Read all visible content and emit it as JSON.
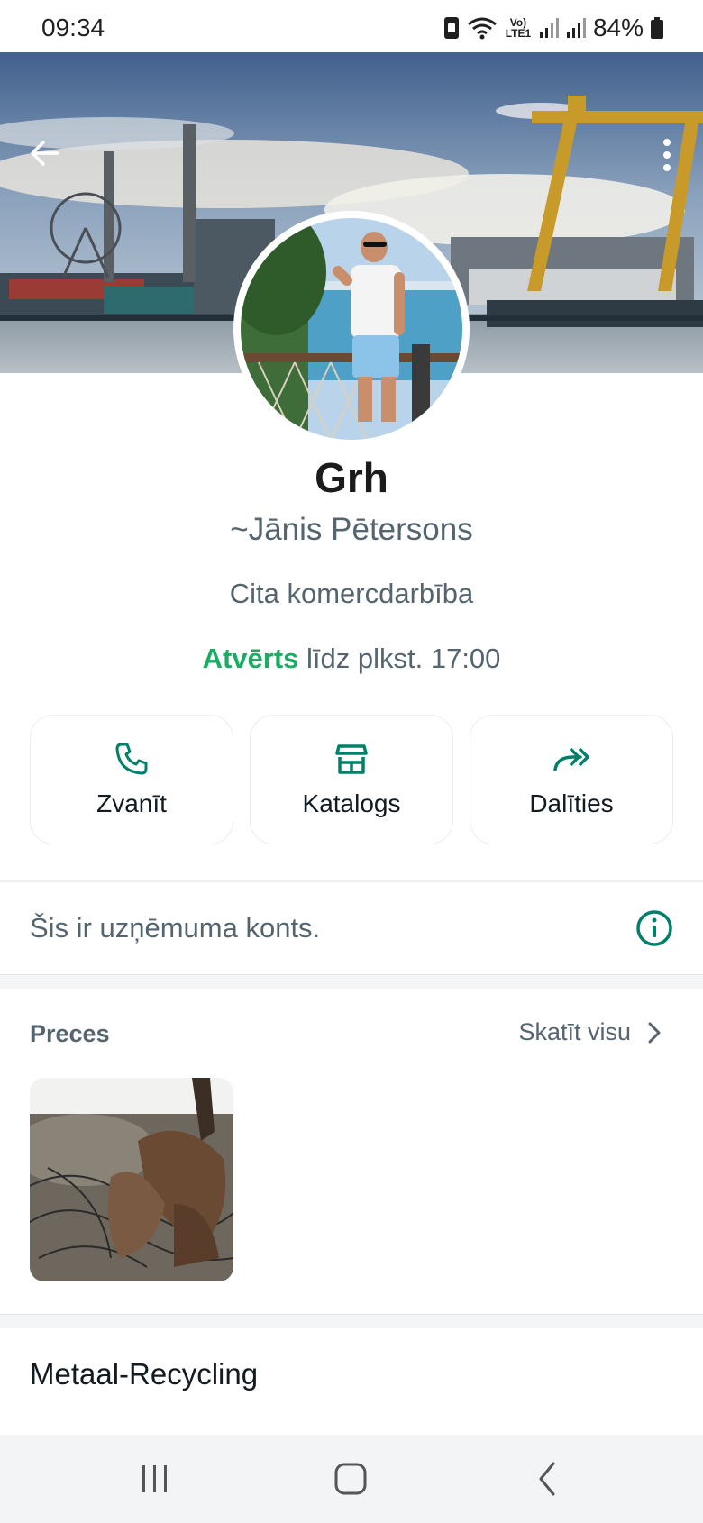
{
  "status_bar": {
    "time": "09:34",
    "battery": "84%",
    "network_label": "Vo) LTE1",
    "icons": [
      "sim-icon",
      "wifi-icon",
      "volte-icon",
      "signal-icon",
      "signal-icon",
      "battery-icon"
    ]
  },
  "header": {
    "back_icon": "arrow-left-icon",
    "menu_icon": "more-vert-icon"
  },
  "profile": {
    "name": "Grh",
    "push_name": "~Jānis Pētersons",
    "category": "Cita komercdarbība",
    "hours_status": "Atvērts",
    "hours_detail": " līdz plkst. 17:00"
  },
  "actions": [
    {
      "label": "Zvanīt",
      "icon": "phone-icon"
    },
    {
      "label": "Katalogs",
      "icon": "storefront-icon"
    },
    {
      "label": "Dalīties",
      "icon": "share-forward-icon"
    }
  ],
  "business_notice": {
    "text": "Šis ir uzņēmuma konts.",
    "icon": "info-icon"
  },
  "products": {
    "title": "Preces",
    "see_all": "Skatīt visu"
  },
  "description": "Metaal-Recycling",
  "colors": {
    "accent": "#1daa61",
    "secondary_text": "#54656f",
    "icon_green": "#008069"
  }
}
